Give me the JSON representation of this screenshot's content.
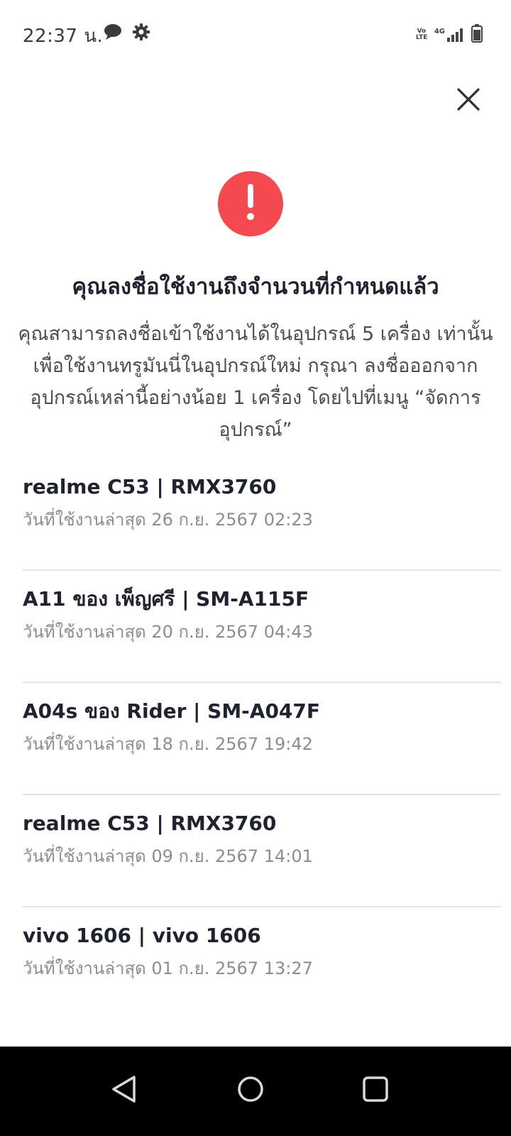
{
  "status_bar": {
    "time": "22:37 น.",
    "network_top": "4G",
    "volte": "Vo LTE"
  },
  "dialog": {
    "title": "คุณลงชื่อใช้งานถึงจำนวนที่กำหนดแล้ว",
    "description": "คุณสามารถลงชื่อเข้าใช้งานได้ในอุปกรณ์ 5 เครื่อง เท่านั้น เพื่อใช้งานทรูมันนี่ในอุปกรณ์ใหม่ กรุณา ลงชื่อออกจากอุปกรณ์เหล่านี้อย่างน้อย 1 เครื่อง โดยไปที่เมนู “จัดการอุปกรณ์”",
    "accent_color": "#f4494f"
  },
  "devices": [
    {
      "name": "realme C53 | RMX3760",
      "last_used": "วันที่ใช้งานล่าสุด 26 ก.ย. 2567 02:23"
    },
    {
      "name": "A11 ของ เพ็ญศรี | SM-A115F",
      "last_used": "วันที่ใช้งานล่าสุด 20 ก.ย. 2567 04:43"
    },
    {
      "name": "A04s ของ Rider | SM-A047F",
      "last_used": "วันที่ใช้งานล่าสุด 18 ก.ย. 2567 19:42"
    },
    {
      "name": "realme C53 | RMX3760",
      "last_used": "วันที่ใช้งานล่าสุด 09 ก.ย. 2567 14:01"
    },
    {
      "name": "vivo 1606 | vivo 1606",
      "last_used": "วันที่ใช้งานล่าสุด 01 ก.ย. 2567 13:27"
    }
  ],
  "icons": {
    "close": "close-icon",
    "alert": "exclamation-icon",
    "nav_back": "back-triangle-icon",
    "nav_home": "home-circle-icon",
    "nav_recents": "recents-square-icon"
  }
}
